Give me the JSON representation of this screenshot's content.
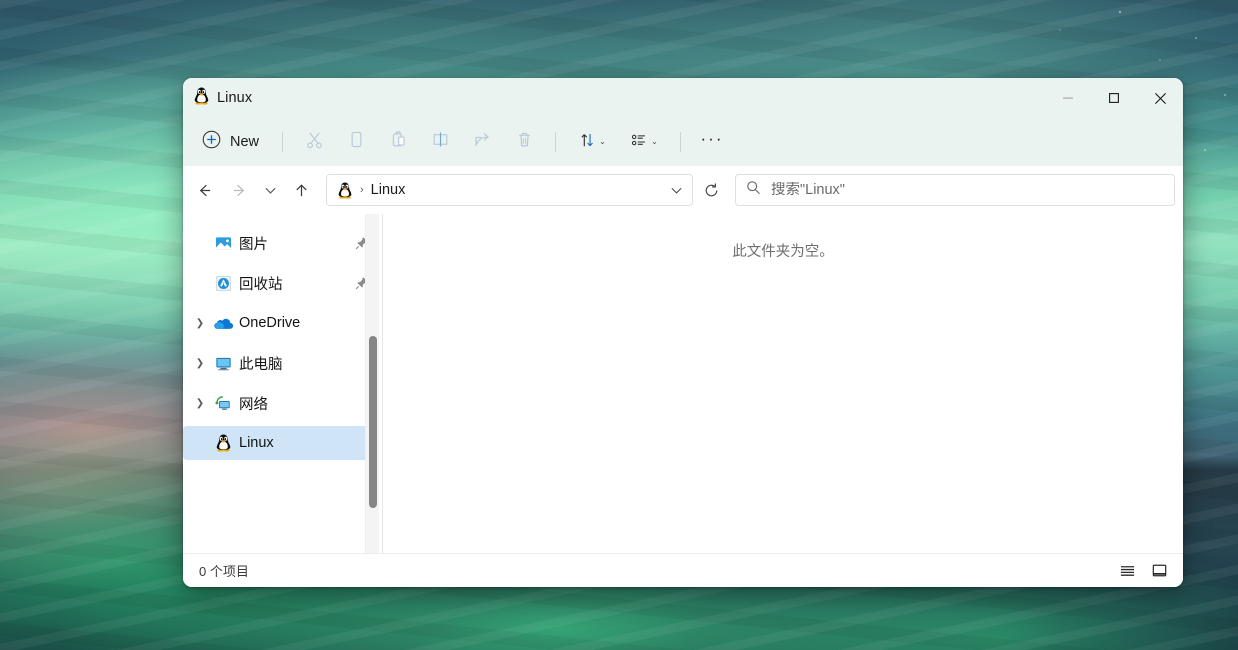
{
  "window": {
    "title": "Linux",
    "app_icon": "tux-penguin-icon",
    "controls": {
      "minimize": "minimize-icon",
      "maximize": "maximize-icon",
      "close": "close-icon"
    }
  },
  "toolbar": {
    "new_label": "New",
    "new_icon": "plus-circle-icon",
    "buttons": [
      {
        "name": "cut",
        "icon": "scissors-icon",
        "enabled": false
      },
      {
        "name": "copy",
        "icon": "copy-icon",
        "enabled": false
      },
      {
        "name": "paste",
        "icon": "clipboard-paste-icon",
        "enabled": false
      },
      {
        "name": "rename",
        "icon": "rename-icon",
        "enabled": false
      },
      {
        "name": "share",
        "icon": "share-icon",
        "enabled": false
      },
      {
        "name": "delete",
        "icon": "trash-icon",
        "enabled": false
      }
    ],
    "sort_icon": "sort-arrows-icon",
    "view_icon": "view-layout-icon",
    "more_label": "···",
    "caret": "⌄"
  },
  "navbar": {
    "back_icon": "arrow-left-icon",
    "forward_icon": "arrow-right-icon",
    "recent_icon": "chevron-down-icon",
    "up_icon": "arrow-up-icon",
    "breadcrumb": {
      "icon": "tux-penguin-icon",
      "separator": "›",
      "path": [
        "Linux"
      ]
    },
    "breadcrumb_dropdown_icon": "chevron-down-icon",
    "refresh_icon": "refresh-icon",
    "search": {
      "icon": "search-icon",
      "placeholder": "搜索\"Linux\"",
      "value": ""
    }
  },
  "sidebar": {
    "items": [
      {
        "label": "图片",
        "icon": "pictures-folder-icon",
        "chevron": false,
        "pinned": true,
        "selected": false
      },
      {
        "label": "回收站",
        "icon": "recycle-bin-icon",
        "chevron": false,
        "pinned": true,
        "selected": false
      },
      {
        "label": "OneDrive",
        "icon": "onedrive-cloud-icon",
        "chevron": true,
        "pinned": false,
        "selected": false
      },
      {
        "label": "此电脑",
        "icon": "this-pc-monitor-icon",
        "chevron": true,
        "pinned": false,
        "selected": false
      },
      {
        "label": "网络",
        "icon": "network-icon",
        "chevron": true,
        "pinned": false,
        "selected": false
      },
      {
        "label": "Linux",
        "icon": "tux-penguin-icon",
        "chevron": false,
        "pinned": false,
        "selected": true
      }
    ],
    "chevron_glyph": "❯",
    "pin_icon": "pushpin-icon"
  },
  "content": {
    "empty_message": "此文件夹为空。"
  },
  "statusbar": {
    "item_count_text": "0 个项目",
    "details_view_icon": "details-view-icon",
    "large_icons_view_icon": "large-icons-view-icon"
  },
  "colors": {
    "titlebar_bg": "#eaf3f0",
    "selection_bg": "#cfe4f7",
    "accent_blue": "#0f6cbd",
    "window_bg": "#ffffff"
  }
}
